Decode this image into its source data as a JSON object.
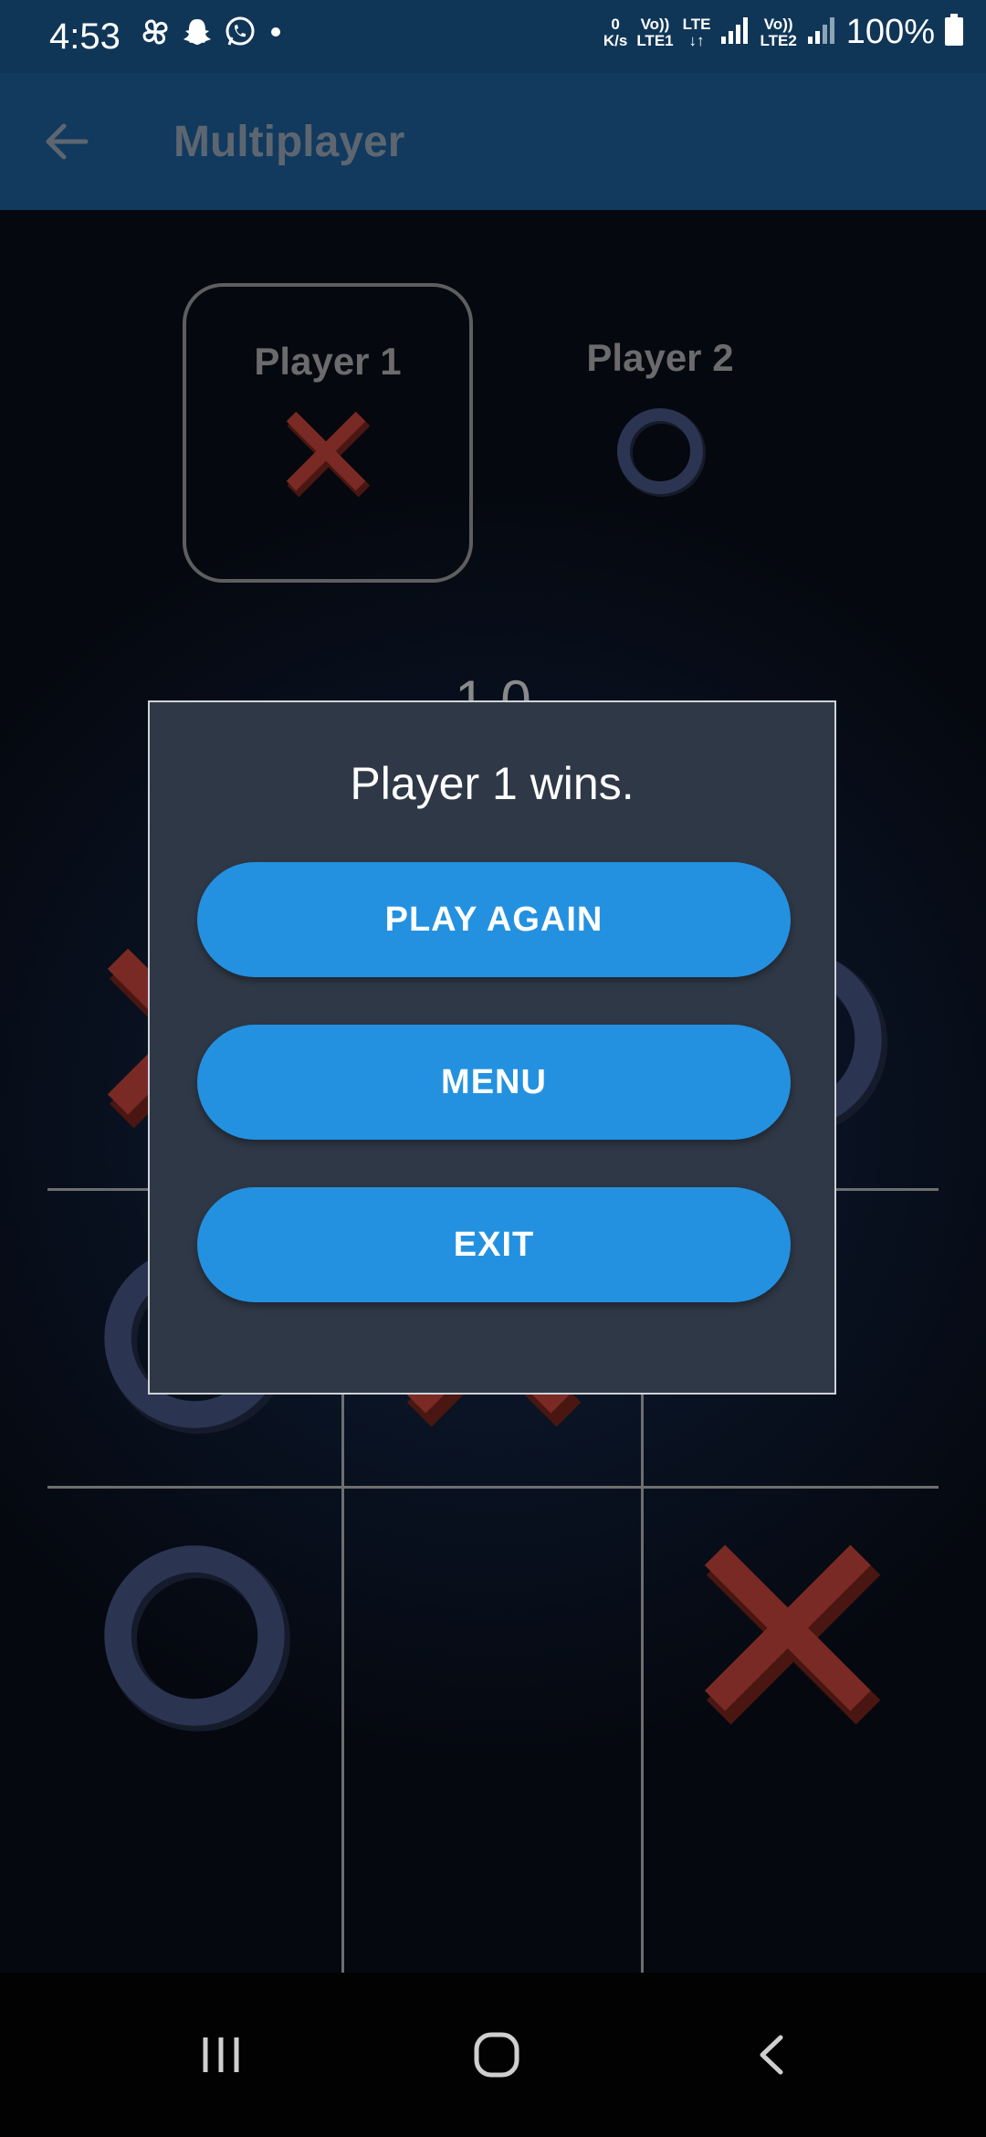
{
  "status_bar": {
    "time": "4:53",
    "net_speed_value": "0",
    "net_speed_unit": "K/s",
    "sim1_top": "Vo))",
    "sim1_bottom": "LTE1",
    "lte_label": "LTE",
    "sim2_top": "Vo))",
    "sim2_bottom": "LTE2",
    "battery": "100%"
  },
  "app_bar": {
    "title": "Multiplayer"
  },
  "players": [
    {
      "name": "Player 1",
      "mark": "X",
      "active": true
    },
    {
      "name": "Player 2",
      "mark": "O",
      "active": false
    }
  ],
  "score": "1  0",
  "board": [
    "X",
    "",
    "O",
    "O",
    "X",
    "",
    "O",
    "",
    "X"
  ],
  "dialog": {
    "message": "Player 1 wins.",
    "buttons": [
      "PLAY AGAIN",
      "MENU",
      "EXIT"
    ]
  },
  "colors": {
    "x_mark": "#7a2a24",
    "o_mark": "#2b3552",
    "accent_button": "#2391e0",
    "dialog_bg": "#2f3846"
  }
}
